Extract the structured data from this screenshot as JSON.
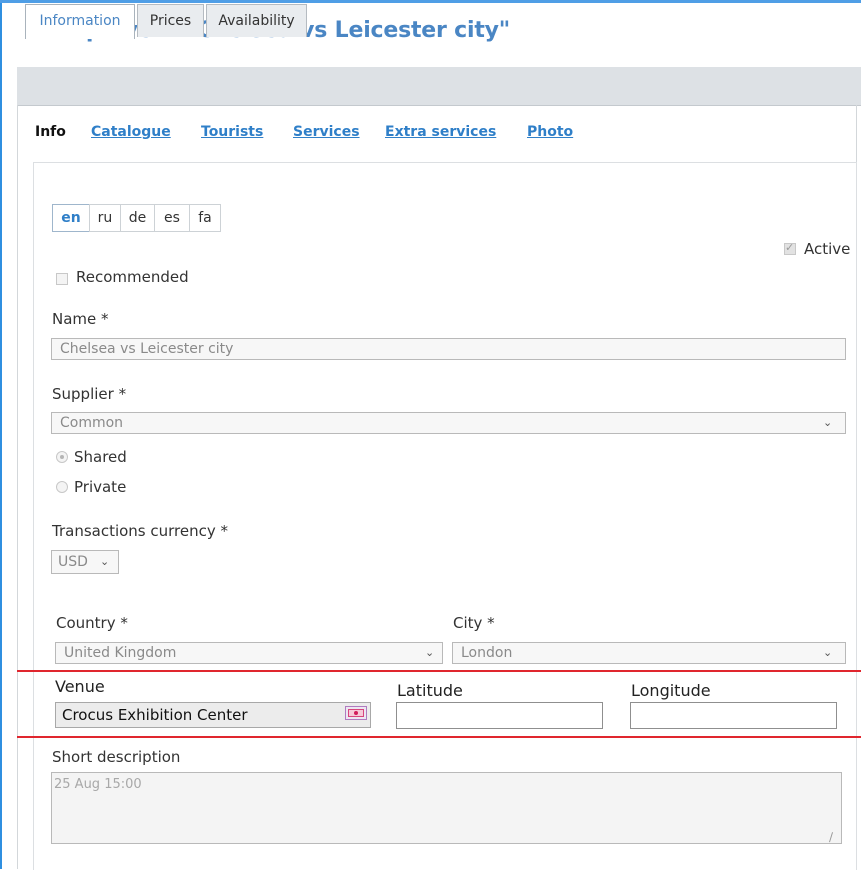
{
  "page": {
    "title": "Group event \"Chelsea vs Leicester city\""
  },
  "tabs": [
    "Information",
    "Prices",
    "Availability"
  ],
  "subnav": {
    "current": "Info",
    "links": [
      "Catalogue",
      "Tourists",
      "Services",
      "Extra services",
      "Photo"
    ]
  },
  "languages": [
    "en",
    "ru",
    "de",
    "es",
    "fa"
  ],
  "form": {
    "active_label": "Active",
    "active_checked": true,
    "recommended_label": "Recommended",
    "recommended_checked": false,
    "name_label": "Name *",
    "name_value": "Chelsea vs Leicester city",
    "supplier_label": "Supplier *",
    "supplier_value": "Common",
    "shared_label": "Shared",
    "private_label": "Private",
    "currency_label": "Transactions currency *",
    "currency_value": "USD",
    "country_label": "Country *",
    "country_value": "United Kingdom",
    "city_label": "City *",
    "city_value": "London",
    "venue_label": "Venue",
    "venue_value": "Crocus Exhibition Center",
    "latitude_label": "Latitude",
    "latitude_value": "",
    "longitude_label": "Longitude",
    "longitude_value": "",
    "short_desc_label": "Short description",
    "short_desc_value": "25 Aug 15:00"
  },
  "colors": {
    "title": "#4a86c4",
    "link": "#2f7fc8",
    "highlight": "#e0262e"
  }
}
